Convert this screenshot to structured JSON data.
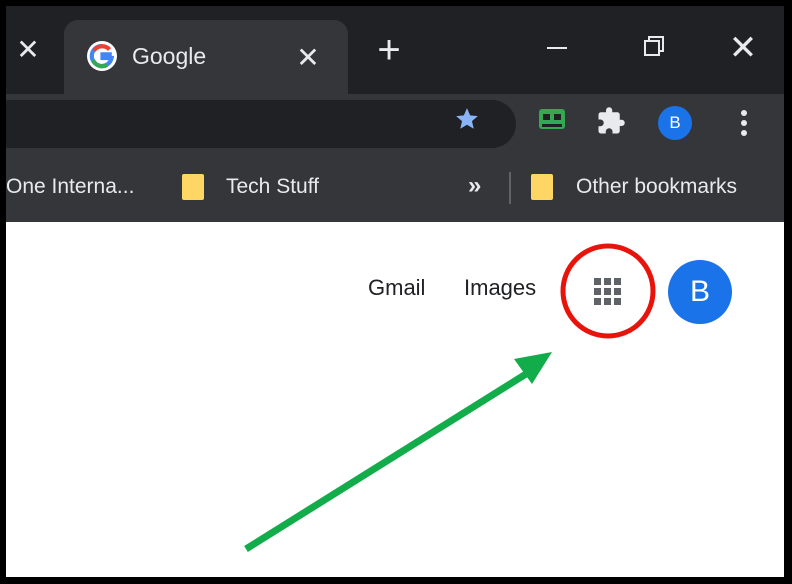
{
  "browser": {
    "tab": {
      "title": "Google",
      "close_glyph": "✕",
      "favicon": "google-g-icon"
    },
    "prev_tab_close_glyph": "✕",
    "new_tab_glyph": "+",
    "window_close_glyph": "✕",
    "toolbar": {
      "profile_initial": "B"
    },
    "bookmarks": {
      "truncated_label": "One Interna...",
      "folder_label": "Tech Stuff",
      "overflow_glyph": "»",
      "other_label": "Other bookmarks"
    }
  },
  "page": {
    "links": {
      "gmail": "Gmail",
      "images": "Images"
    },
    "avatar_initial": "B"
  },
  "colors": {
    "titlebar": "#202124",
    "toolbar": "#35363a",
    "accent_blue": "#1a73e8",
    "folder_yellow": "#fdd663",
    "annotation_circle": "#e8140c",
    "annotation_arrow": "#13ac4b"
  },
  "annotations": {
    "circle": "red circle highlighting the apps button",
    "arrow": "green arrow pointing at the apps button"
  }
}
